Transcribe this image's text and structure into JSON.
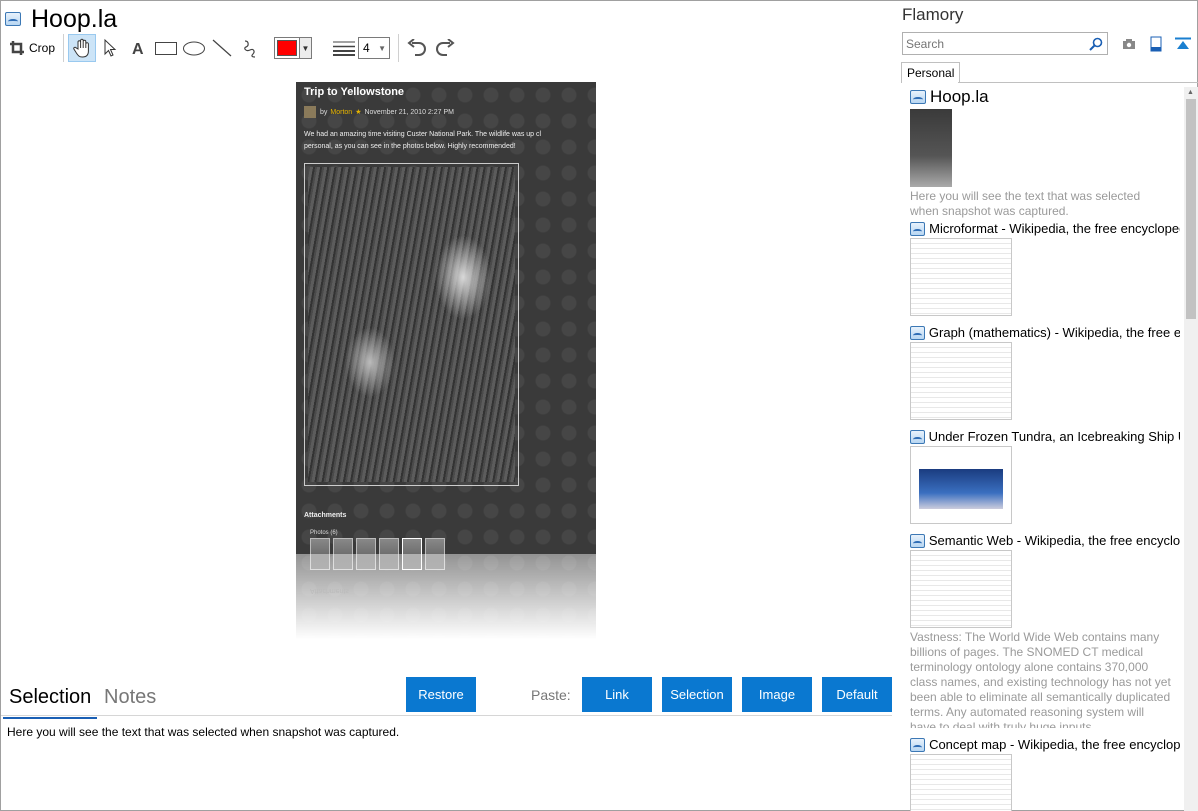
{
  "editor": {
    "title": "Hoop.la",
    "toolbar": {
      "crop_label": "Crop",
      "tools": [
        "hand-tool",
        "pointer-tool",
        "text-tool",
        "rectangle-tool",
        "ellipse-tool",
        "line-tool",
        "freehand-tool"
      ],
      "color": "#ff0000",
      "line_width": "4"
    },
    "preview": {
      "post_title": "Trip to Yellowstone",
      "by": "by",
      "author": "Morton",
      "date": "November 21, 2010 2:27 PM",
      "body": "We had an amazing time visiting Custer National Park.  The wildlife was up cl\npersonal, as you can see in the photos below.  Highly recommended!",
      "attachments_label": "Attachments",
      "photos_label": "Photos (6)"
    },
    "tabs": {
      "selection": "Selection",
      "notes": "Notes"
    },
    "buttons": {
      "restore": "Restore",
      "paste_label": "Paste:",
      "link": "Link",
      "selection": "Selection",
      "image": "Image",
      "default": "Default"
    },
    "selection_text": "Here you will see the text that was selected when snapshot was captured."
  },
  "sidebar": {
    "app_name": "Flamory",
    "search_placeholder": "Search",
    "tab": "Personal",
    "items": [
      {
        "title": "Hoop.la",
        "desc": "Here you will see the text that was selected when snapshot was captured."
      },
      {
        "title": "Microformat - Wikipedia, the free encyclopedia"
      },
      {
        "title": "Graph (mathematics) - Wikipedia, the free ency"
      },
      {
        "title": "Under Frozen Tundra, an Icebreaking Ship Unco"
      },
      {
        "title": "Semantic Web - Wikipedia, the free encycloped",
        "desc": "Vastness: The World Wide Web contains many billions of pages. The SNOMED CT medical terminology ontology alone contains 370,000 class names, and existing technology has not yet been able to eliminate all semantically duplicated terms. Any automated reasoning system will have to deal with truly huge inputs."
      },
      {
        "title": "Concept map - Wikipedia, the free encyclopedi"
      }
    ]
  },
  "colors": {
    "accent": "#0a78d0",
    "tab_underline": "#1a5fb4"
  }
}
